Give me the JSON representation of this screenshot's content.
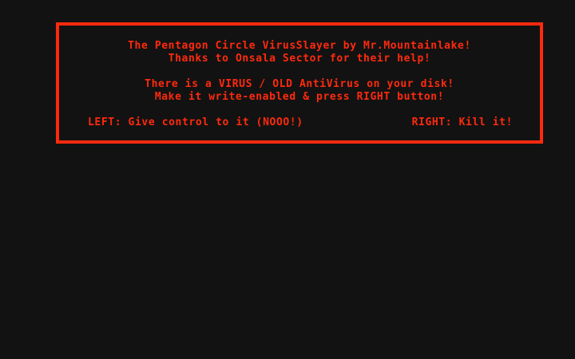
{
  "dialog": {
    "title_line": "The Pentagon Circle VirusSlayer by Mr.Mountainlake!",
    "thanks_line": "Thanks to Onsala Sector for their help!",
    "warning_line": "There is a VIRUS / OLD AntiVirus on your disk!",
    "instruction_line": "Make it write-enabled & press RIGHT button!",
    "left_option": "LEFT: Give control to it (NOOO!)",
    "right_option": "RIGHT: Kill it!"
  },
  "colors": {
    "text": "#ff2a0e",
    "border": "#ff2a0e",
    "background": "#121212"
  }
}
